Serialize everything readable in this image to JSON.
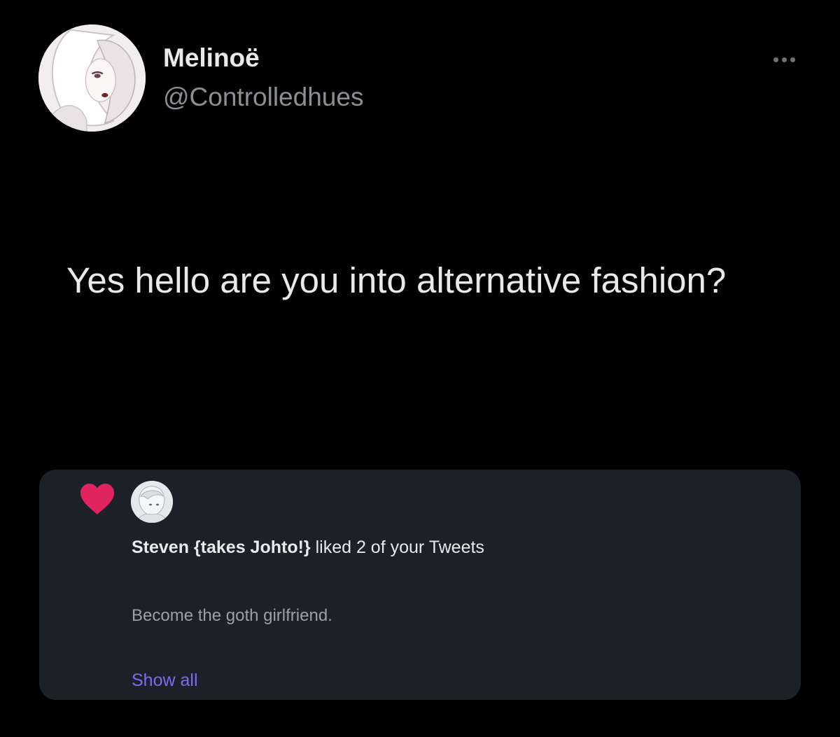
{
  "tweet": {
    "author": {
      "display_name": "Melinoë",
      "handle": "@Controlledhues",
      "avatar": "anime-illustration-avatar"
    },
    "more_icon": "more-horizontal-icon",
    "text": "Yes hello are you into alternative fashion?"
  },
  "notification_card": {
    "icon": "heart-icon",
    "liker_avatar": "anime-character-avatar",
    "liker_name": "Steven {takes Johto!}",
    "action_text": " liked 2 of your Tweets",
    "snippet": "Become the goth girlfriend.",
    "show_all_label": "Show all"
  },
  "colors": {
    "background": "#000000",
    "card_background": "#1c2029",
    "heart": "#e0245e",
    "link": "#7e6cf0",
    "secondary_text": "#8b8f94"
  }
}
